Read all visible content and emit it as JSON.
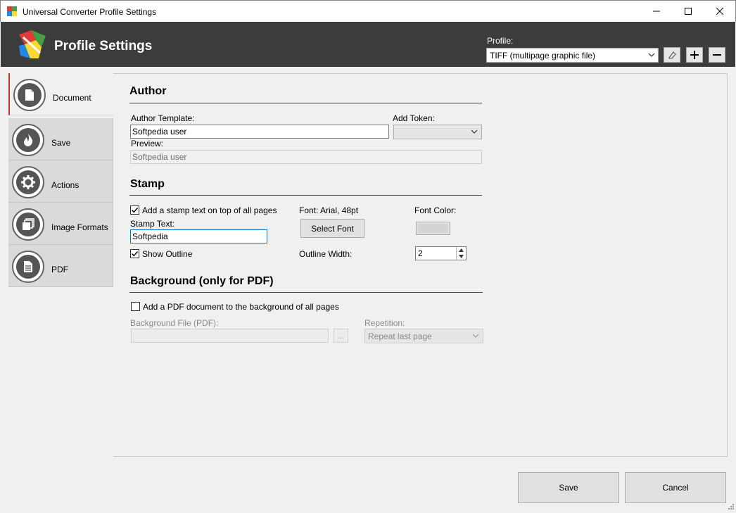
{
  "window": {
    "title": "Universal Converter Profile Settings"
  },
  "header": {
    "title": "Profile Settings",
    "profile_label": "Profile:",
    "profile_value": "TIFF (multipage graphic file)"
  },
  "nav": {
    "items": [
      {
        "label": "Document",
        "icon": "document-icon"
      },
      {
        "label": "Save",
        "icon": "flame-icon"
      },
      {
        "label": "Actions",
        "icon": "gear-icon"
      },
      {
        "label": "Image Formats",
        "icon": "layers-icon"
      },
      {
        "label": "PDF",
        "icon": "pdf-file-icon"
      }
    ],
    "active": "Document"
  },
  "author": {
    "title": "Author",
    "template_label": "Author Template:",
    "template_value": "Softpedia user",
    "token_label": "Add Token:",
    "token_value": "",
    "preview_label": "Preview:",
    "preview_value": "Softpedia user"
  },
  "stamp": {
    "title": "Stamp",
    "add_stamp_label": "Add a stamp text on top of all pages",
    "add_stamp_checked": true,
    "font_label": "Font: Arial, 48pt",
    "font_color_label": "Font Color:",
    "font_color": "#d4d4d4",
    "stamp_text_label": "Stamp Text:",
    "stamp_text_value": "Softpedia",
    "select_font_label": "Select Font",
    "show_outline_label": "Show Outline",
    "show_outline_checked": true,
    "outline_width_label": "Outline Width:",
    "outline_width_value": "2"
  },
  "background": {
    "title": "Background (only for PDF)",
    "add_bg_label": "Add a PDF document to the background of all pages",
    "add_bg_checked": false,
    "file_label": "Background File (PDF):",
    "file_value": "",
    "browse_label": "...",
    "repetition_label": "Repetition:",
    "repetition_value": "Repeat last page"
  },
  "footer": {
    "save_label": "Save",
    "cancel_label": "Cancel"
  },
  "colors": {
    "header_bg": "#3c3c3c",
    "active_tab_accent": "#c0392b",
    "focus_border": "#0078d7"
  }
}
